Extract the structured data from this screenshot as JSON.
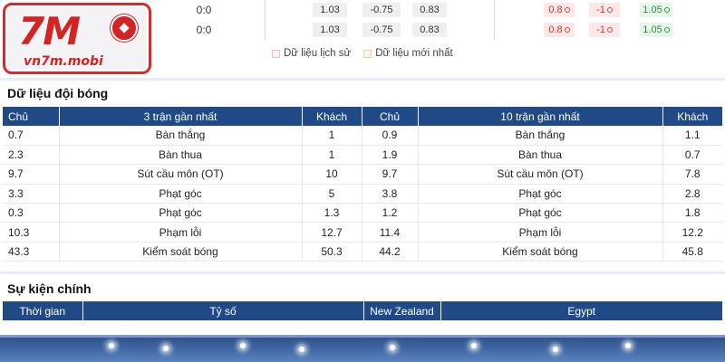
{
  "odds_rows": [
    {
      "score": "0:0",
      "a": "1.03",
      "b": "-0.75",
      "c": "0.83",
      "d": "0.8",
      "e": "-1",
      "f": "1.05"
    },
    {
      "score": "0:0",
      "a": "1.03",
      "b": "-0.75",
      "c": "0.83",
      "d": "0.8",
      "e": "-1",
      "f": "1.05"
    }
  ],
  "legend": {
    "history": "Dữ liệu lịch sử",
    "latest": "Dữ liệu mới nhất"
  },
  "logo": {
    "text": "7M",
    "sub": "vn7m.mobi"
  },
  "team_data": {
    "title": "Dữ liệu đội bóng",
    "headers": [
      "Chủ",
      "3 trận gần nhất",
      "Khách",
      "Chủ",
      "10 trận gần nhất",
      "Khách"
    ],
    "rows": [
      [
        "0.7",
        "Bàn thắng",
        "1",
        "0.9",
        "Bàn thắng",
        "1.1"
      ],
      [
        "2.3",
        "Bàn thua",
        "1",
        "1.9",
        "Bàn thua",
        "0.7"
      ],
      [
        "9.7",
        "Sút cầu môn (OT)",
        "10",
        "9.7",
        "Sút cầu môn (OT)",
        "7.8"
      ],
      [
        "3.3",
        "Phạt góc",
        "5",
        "3.8",
        "Phạt góc",
        "2.8"
      ],
      [
        "0.3",
        "Phạt góc",
        "1.3",
        "1.2",
        "Phạt góc",
        "1.8"
      ],
      [
        "10.3",
        "Phạm lỗi",
        "12.7",
        "11.4",
        "Phạm lỗi",
        "12.2"
      ],
      [
        "43.3",
        "Kiểm soát bóng",
        "50.3",
        "44.2",
        "Kiểm soát bóng",
        "45.8"
      ]
    ]
  },
  "events": {
    "title": "Sự kiện chính",
    "headers": [
      "Thời gian",
      "Tỷ số",
      "New Zealand",
      "Egypt"
    ]
  },
  "colors": {
    "header_bg": "#1f4a86",
    "logo_red": "#d32323"
  }
}
